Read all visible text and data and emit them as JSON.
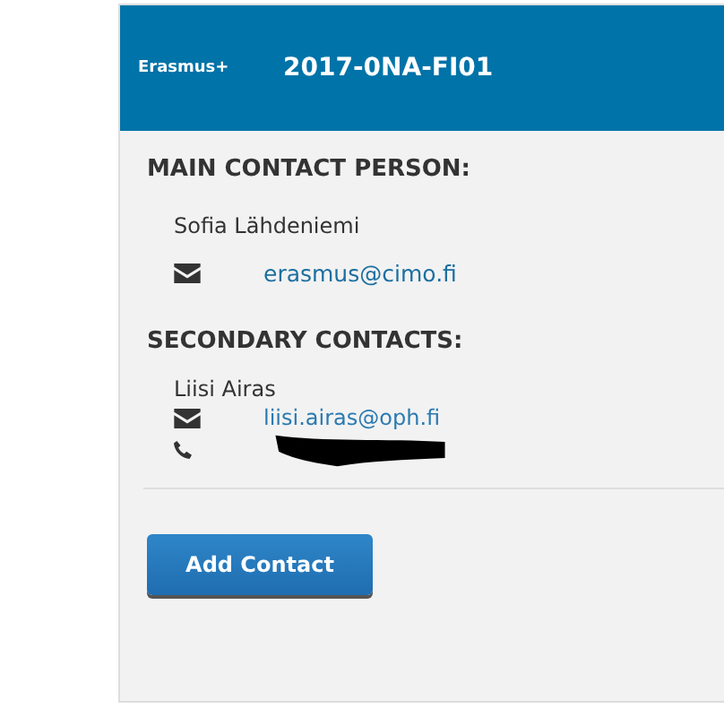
{
  "header": {
    "brand": "Erasmus+",
    "code": "2017-0NA-FI01"
  },
  "main_contact": {
    "heading": "MAIN CONTACT PERSON:",
    "name": "Sofia Lähdeniemi",
    "email": "erasmus@cimo.fi"
  },
  "secondary_contacts": {
    "heading": "SECONDARY CONTACTS:",
    "items": [
      {
        "name": "Liisi Airas",
        "email": "liisi.airas@oph.fi",
        "phone_redacted": true
      }
    ]
  },
  "add_button": "Add Contact"
}
